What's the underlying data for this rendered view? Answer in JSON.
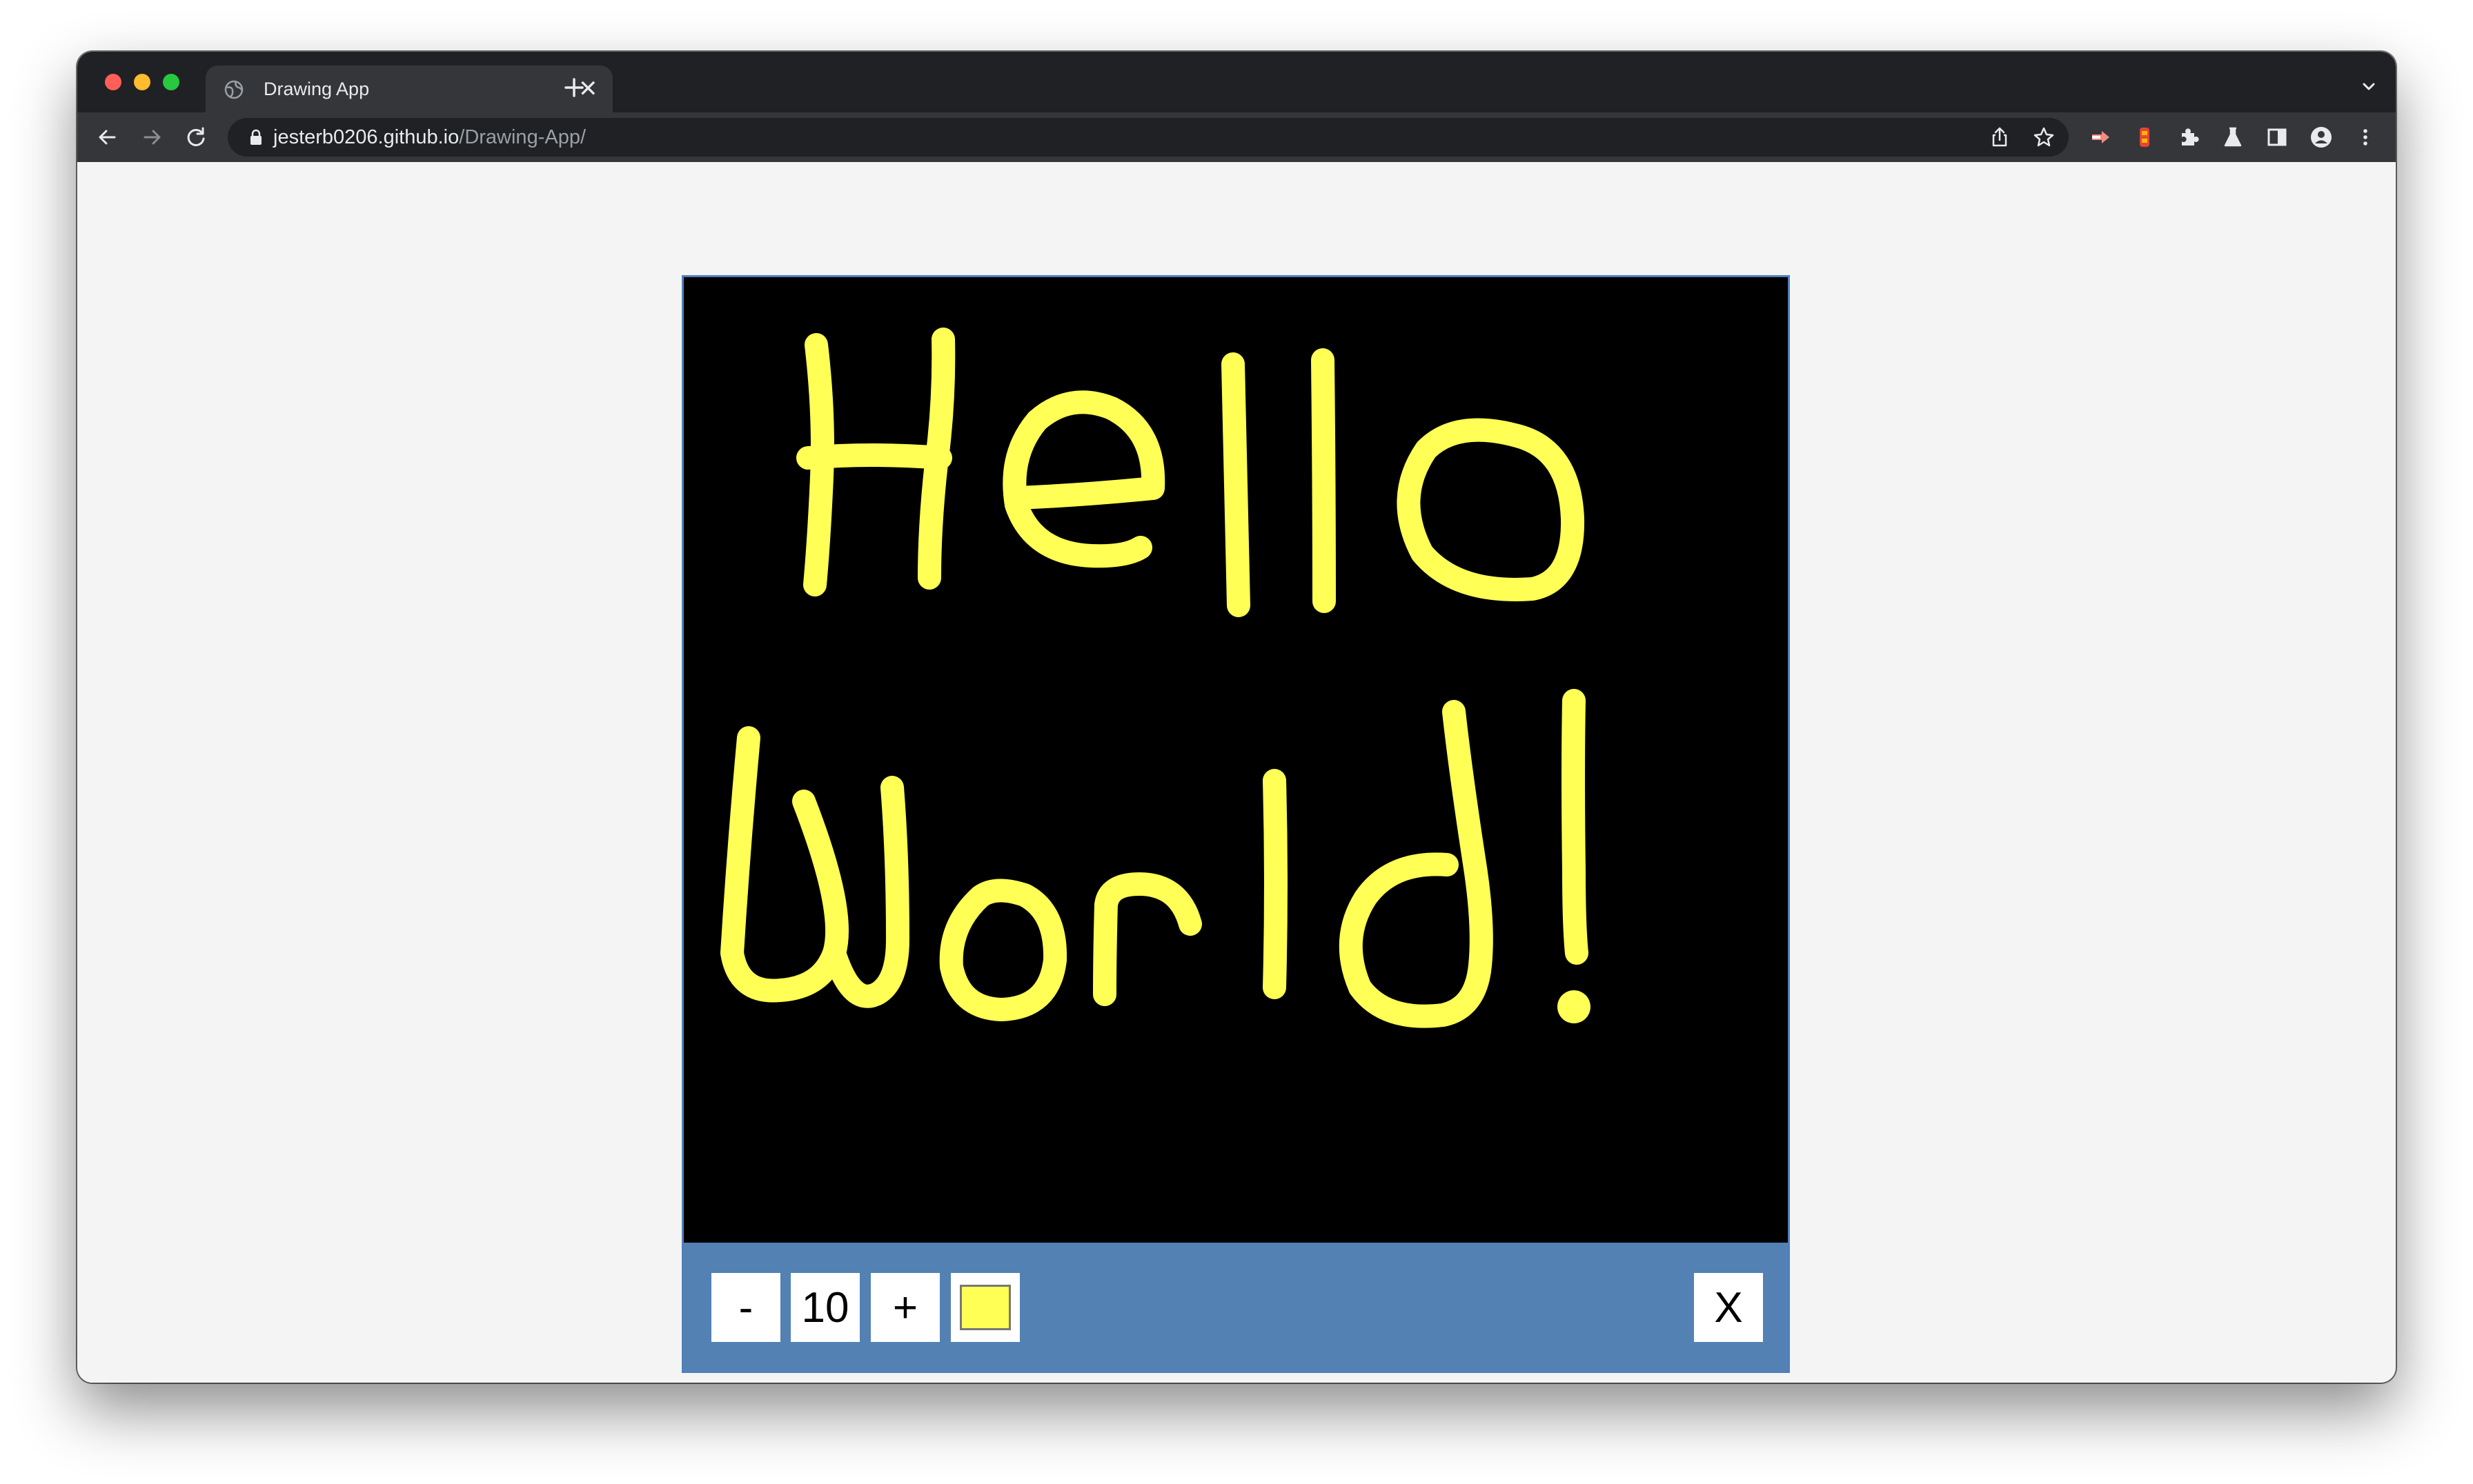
{
  "browser": {
    "tab": {
      "title": "Drawing App"
    },
    "url": {
      "host": "jesterb0206.github.io",
      "path": "/Drawing-App/"
    }
  },
  "app": {
    "canvas": {
      "background": "#000000",
      "stroke_color": "#ffff55",
      "drawn_text": "Hello World!"
    },
    "controls": {
      "decrease_label": "-",
      "size_value": "10",
      "increase_label": "+",
      "color_value": "#ffff55",
      "clear_label": "X"
    },
    "colors": {
      "toolbar_bg": "#5381b4",
      "page_bg": "#f4f4f5"
    }
  },
  "icons": [
    "globe-icon",
    "close-icon",
    "plus-icon",
    "chevron-down-icon",
    "back-arrow-icon",
    "forward-arrow-icon",
    "reload-icon",
    "lock-icon",
    "share-icon",
    "star-icon",
    "extension-icon",
    "puzzle-icon",
    "flask-icon",
    "sidebar-icon",
    "profile-icon",
    "kebab-menu-icon"
  ]
}
